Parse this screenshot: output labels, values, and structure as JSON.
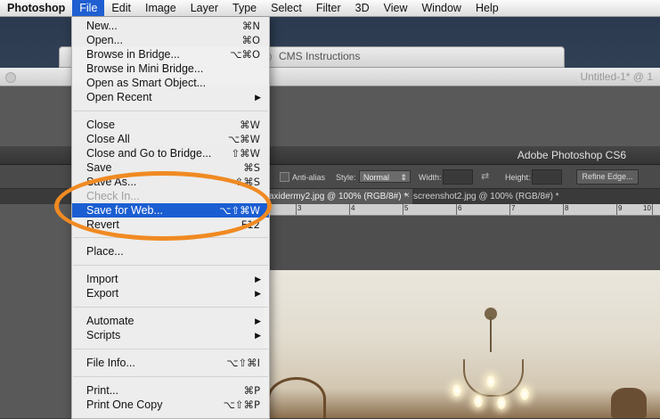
{
  "menubar": {
    "items": [
      "Photoshop",
      "File",
      "Edit",
      "Image",
      "Layer",
      "Type",
      "Select",
      "Filter",
      "3D",
      "View",
      "Window",
      "Help"
    ]
  },
  "background_windows": {
    "cms_title": "CMS Instructions",
    "untitled_title": "Untitled-1* @ 1"
  },
  "photoshop": {
    "title": "Adobe Photoshop CS6",
    "options": {
      "antialias": "Anti-alias",
      "style_label": "Style:",
      "style_value": "Normal",
      "width_label": "Width:",
      "height_label": "Height:",
      "refine_edge": "Refine Edge..."
    },
    "tabs": [
      {
        "label": "axidermy2.jpg @ 100% (RGB/8#) *"
      },
      {
        "label": "screenshot2.jpg @ 100% (RGB/8#) *"
      }
    ],
    "ruler_numbers": [
      "3",
      "4",
      "5",
      "6",
      "7",
      "8",
      "9",
      "10"
    ]
  },
  "file_menu": {
    "items": [
      {
        "label": "New...",
        "shortcut": "⌘N"
      },
      {
        "label": "Open...",
        "shortcut": "⌘O"
      },
      {
        "label": "Browse in Bridge...",
        "shortcut": "⌥⌘O"
      },
      {
        "label": "Browse in Mini Bridge..."
      },
      {
        "label": "Open as Smart Object..."
      },
      {
        "label": "Open Recent",
        "submenu": "▶"
      },
      {
        "label": "Close",
        "shortcut": "⌘W"
      },
      {
        "label": "Close All",
        "shortcut": "⌥⌘W"
      },
      {
        "label": "Close and Go to Bridge...",
        "shortcut": "⇧⌘W"
      },
      {
        "label": "Save",
        "shortcut": "⌘S"
      },
      {
        "label": "Save As...",
        "shortcut": "⇧⌘S"
      },
      {
        "label": "Check In..."
      },
      {
        "label": "Save for Web...",
        "shortcut": "⌥⇧⌘W"
      },
      {
        "label": "Revert",
        "shortcut": "F12"
      },
      {
        "label": "Place..."
      },
      {
        "label": "Import",
        "submenu": "▶"
      },
      {
        "label": "Export",
        "submenu": "▶"
      },
      {
        "label": "Automate",
        "submenu": "▶"
      },
      {
        "label": "Scripts",
        "submenu": "▶"
      },
      {
        "label": "File Info...",
        "shortcut": "⌥⇧⌘I"
      },
      {
        "label": "Print...",
        "shortcut": "⌘P"
      },
      {
        "label": "Print One Copy",
        "shortcut": "⌥⇧⌘P"
      }
    ]
  },
  "colors": {
    "highlight": "#1b5ed2",
    "annotation": "#f08a22"
  }
}
